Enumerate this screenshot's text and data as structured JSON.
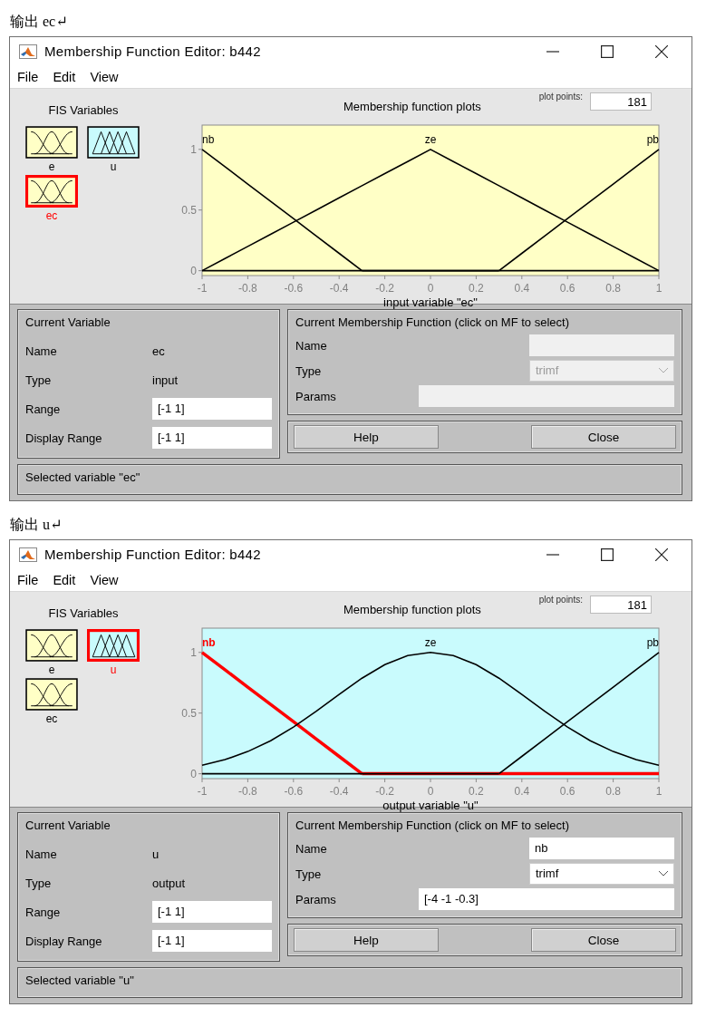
{
  "sections": [
    {
      "caption": "输出 ec↵",
      "window": {
        "title": "Membership Function Editor: b442",
        "menu": [
          "File",
          "Edit",
          "View"
        ],
        "fis_variables": {
          "heading": "FIS Variables",
          "items": [
            {
              "name": "e",
              "kind": "input",
              "selected": false
            },
            {
              "name": "u",
              "kind": "output",
              "selected": false
            },
            {
              "name": "ec",
              "kind": "input",
              "selected": true
            }
          ]
        },
        "plot": {
          "plot_points_label": "plot points:",
          "plot_points": "181",
          "chart_data": {
            "type": "line",
            "title": "Membership function plots",
            "xlabel": "input variable \"ec\"",
            "x": [
              -1,
              -0.9,
              -0.8,
              -0.7,
              -0.6,
              -0.5,
              -0.4,
              -0.3,
              -0.2,
              -0.1,
              0,
              0.1,
              0.2,
              0.3,
              0.4,
              0.5,
              0.6,
              0.7,
              0.8,
              0.9,
              1
            ],
            "series": [
              {
                "name": "nb",
                "color": "#000000",
                "values": [
                  1,
                  0.857,
                  0.714,
                  0.571,
                  0.429,
                  0.286,
                  0.143,
                  0,
                  0,
                  0,
                  0,
                  0,
                  0,
                  0,
                  0,
                  0,
                  0,
                  0,
                  0,
                  0,
                  0
                ]
              },
              {
                "name": "ze",
                "color": "#000000",
                "values": [
                  0,
                  0.1,
                  0.2,
                  0.3,
                  0.4,
                  0.5,
                  0.6,
                  0.7,
                  0.8,
                  0.9,
                  1,
                  0.9,
                  0.8,
                  0.7,
                  0.6,
                  0.5,
                  0.4,
                  0.3,
                  0.2,
                  0.1,
                  0
                ]
              },
              {
                "name": "pb",
                "color": "#000000",
                "values": [
                  0,
                  0,
                  0,
                  0,
                  0,
                  0,
                  0,
                  0,
                  0,
                  0,
                  0,
                  0,
                  0,
                  0,
                  0.143,
                  0.286,
                  0.429,
                  0.571,
                  0.714,
                  0.857,
                  1
                ]
              }
            ],
            "xlim": [
              -1,
              1
            ],
            "ylim": [
              -0.04,
              1.2
            ],
            "xticks": [
              -1,
              -0.8,
              -0.6,
              -0.4,
              -0.2,
              0,
              0.2,
              0.4,
              0.6,
              0.8,
              1
            ],
            "yticks": [
              0,
              0.5,
              1
            ]
          }
        },
        "current_variable": {
          "heading": "Current Variable",
          "rows": [
            {
              "label": "Name",
              "value": "ec",
              "kind": "text"
            },
            {
              "label": "Type",
              "value": "input",
              "kind": "text"
            },
            {
              "label": "Range",
              "value": "[-1 1]",
              "kind": "field"
            },
            {
              "label": "Display Range",
              "value": "[-1 1]",
              "kind": "field"
            }
          ]
        },
        "current_mf": {
          "heading": "Current Membership Function (click on MF to select)",
          "name": {
            "label": "Name",
            "disabled": true
          },
          "type": {
            "label": "Type",
            "value": "trimf",
            "disabled": true
          },
          "params": {
            "label": "Params",
            "disabled": true
          }
        },
        "buttons": [
          "Help",
          "Close"
        ],
        "status": "Selected variable \"ec\""
      }
    },
    {
      "caption": "输出 u↵",
      "window": {
        "title": "Membership Function Editor: b442",
        "menu": [
          "File",
          "Edit",
          "View"
        ],
        "fis_variables": {
          "heading": "FIS Variables",
          "items": [
            {
              "name": "e",
              "kind": "input",
              "selected": false
            },
            {
              "name": "u",
              "kind": "output",
              "selected": true
            },
            {
              "name": "ec",
              "kind": "input",
              "selected": false
            }
          ]
        },
        "plot": {
          "plot_points_label": "plot points:",
          "plot_points": "181",
          "chart_data": {
            "type": "line",
            "title": "Membership function plots",
            "xlabel": "output variable \"u\"",
            "x": [
              -1,
              -0.9,
              -0.8,
              -0.7,
              -0.6,
              -0.5,
              -0.4,
              -0.3,
              -0.2,
              -0.1,
              0,
              0.1,
              0.2,
              0.3,
              0.4,
              0.5,
              0.6,
              0.7,
              0.8,
              0.9,
              1
            ],
            "series": [
              {
                "name": "nb",
                "color": "#ff0000",
                "values": [
                  1,
                  0.857,
                  0.714,
                  0.571,
                  0.429,
                  0.286,
                  0.143,
                  0,
                  0,
                  0,
                  0,
                  0,
                  0,
                  0,
                  0,
                  0,
                  0,
                  0,
                  0,
                  0,
                  0
                ]
              },
              {
                "name": "ze",
                "color": "#000000",
                "values": [
                  0.07,
                  0.116,
                  0.183,
                  0.272,
                  0.385,
                  0.515,
                  0.654,
                  0.788,
                  0.899,
                  0.974,
                  1,
                  0.974,
                  0.899,
                  0.788,
                  0.654,
                  0.515,
                  0.385,
                  0.272,
                  0.183,
                  0.116,
                  0.07
                ]
              },
              {
                "name": "pb",
                "color": "#000000",
                "values": [
                  0,
                  0,
                  0,
                  0,
                  0,
                  0,
                  0,
                  0,
                  0,
                  0,
                  0,
                  0,
                  0,
                  0,
                  0.143,
                  0.286,
                  0.429,
                  0.571,
                  0.714,
                  0.857,
                  1
                ]
              }
            ],
            "xlim": [
              -1,
              1
            ],
            "ylim": [
              -0.04,
              1.2
            ],
            "xticks": [
              -1,
              -0.8,
              -0.6,
              -0.4,
              -0.2,
              0,
              0.2,
              0.4,
              0.6,
              0.8,
              1
            ],
            "yticks": [
              0,
              0.5,
              1
            ]
          }
        },
        "current_variable": {
          "heading": "Current Variable",
          "rows": [
            {
              "label": "Name",
              "value": "u",
              "kind": "text"
            },
            {
              "label": "Type",
              "value": "output",
              "kind": "text"
            },
            {
              "label": "Range",
              "value": "[-1 1]",
              "kind": "field"
            },
            {
              "label": "Display Range",
              "value": "[-1 1]",
              "kind": "field"
            }
          ]
        },
        "current_mf": {
          "heading": "Current Membership Function (click on MF to select)",
          "name": {
            "label": "Name",
            "value": "nb",
            "disabled": false
          },
          "type": {
            "label": "Type",
            "value": "trimf",
            "disabled": false
          },
          "params": {
            "label": "Params",
            "value": "[-4 -1 -0.3]",
            "disabled": false
          }
        },
        "buttons": [
          "Help",
          "Close"
        ],
        "status": "Selected variable \"u\""
      }
    }
  ]
}
